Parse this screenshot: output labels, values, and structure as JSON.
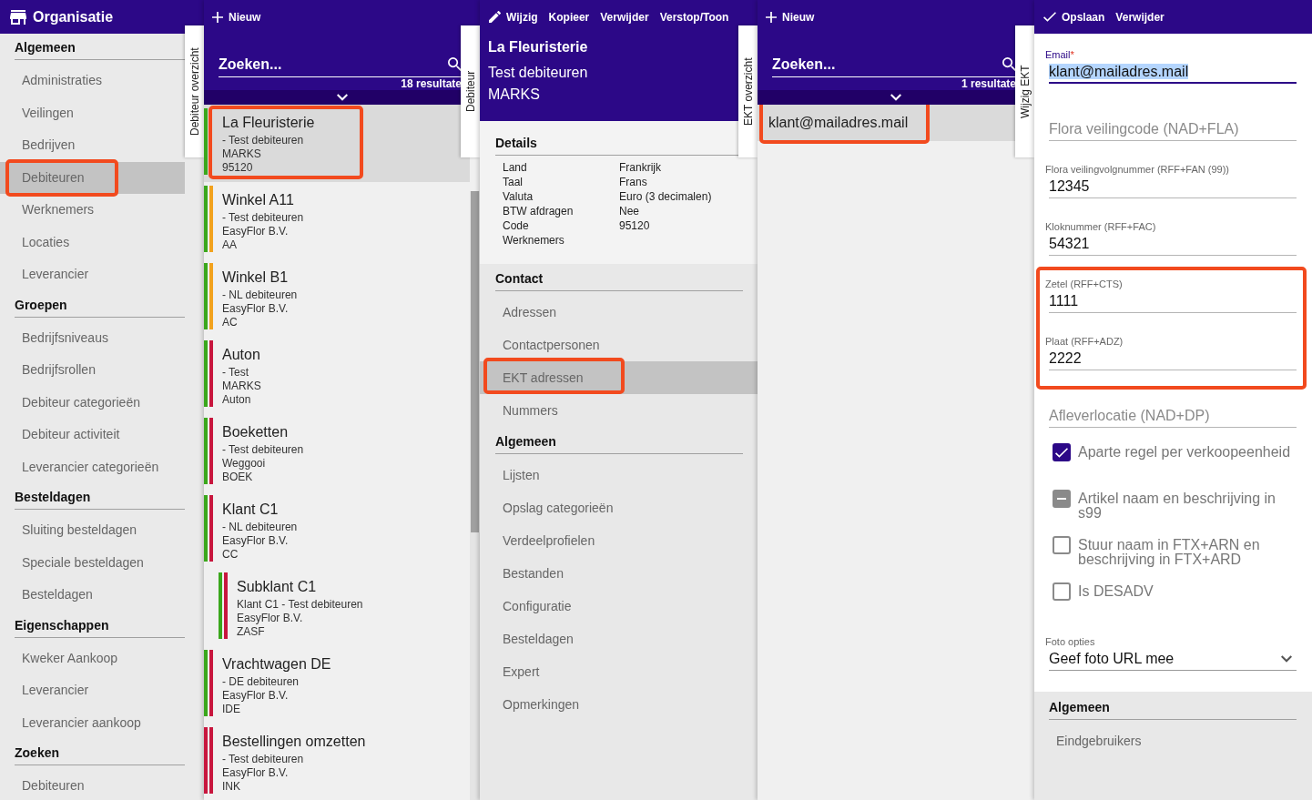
{
  "sidebar": {
    "title": "Organisatie",
    "side_tab": "Debiteur overzicht",
    "sections": [
      {
        "heading": "Algemeen",
        "items": [
          {
            "label": "Administraties",
            "selected": false,
            "highlighted": false
          },
          {
            "label": "Veilingen",
            "selected": false,
            "highlighted": false
          },
          {
            "label": "Bedrijven",
            "selected": false,
            "highlighted": false
          },
          {
            "label": "Debiteuren",
            "selected": true,
            "highlighted": true
          },
          {
            "label": "Werknemers",
            "selected": false,
            "highlighted": false
          },
          {
            "label": "Locaties",
            "selected": false,
            "highlighted": false
          },
          {
            "label": "Leverancier",
            "selected": false,
            "highlighted": false
          }
        ]
      },
      {
        "heading": "Groepen",
        "items": [
          {
            "label": "Bedrijfsniveaus",
            "selected": false,
            "highlighted": false
          },
          {
            "label": "Bedrijfsrollen",
            "selected": false,
            "highlighted": false
          },
          {
            "label": "Debiteur categorieën",
            "selected": false,
            "highlighted": false
          },
          {
            "label": "Debiteur activiteit",
            "selected": false,
            "highlighted": false
          },
          {
            "label": "Leverancier categorieën",
            "selected": false,
            "highlighted": false
          }
        ]
      },
      {
        "heading": "Besteldagen",
        "items": [
          {
            "label": "Sluiting besteldagen",
            "selected": false,
            "highlighted": false
          },
          {
            "label": "Speciale besteldagen",
            "selected": false,
            "highlighted": false
          },
          {
            "label": "Besteldagen",
            "selected": false,
            "highlighted": false
          }
        ]
      },
      {
        "heading": "Eigenschappen",
        "items": [
          {
            "label": "Kweker Aankoop",
            "selected": false,
            "highlighted": false
          },
          {
            "label": "Leverancier",
            "selected": false,
            "highlighted": false
          },
          {
            "label": "Leverancier aankoop",
            "selected": false,
            "highlighted": false
          }
        ]
      },
      {
        "heading": "Zoeken",
        "items": [
          {
            "label": "Debiteuren",
            "selected": false,
            "highlighted": false
          }
        ]
      }
    ]
  },
  "debtor_list": {
    "toolbar": [
      {
        "kind": "add",
        "label": "Nieuw"
      }
    ],
    "search": {
      "placeholder": "Zoeken..."
    },
    "result_count": "18 resultate",
    "side_tab": "Debiteur",
    "items": [
      {
        "title": "La Fleuristerie",
        "lines": [
          "- Test debiteuren",
          "MARKS",
          "95120"
        ],
        "bars": [
          {
            "color": "#3aa71c"
          }
        ],
        "selected": true,
        "highlighted": true
      },
      {
        "title": "Winkel A11",
        "lines": [
          "- Test debiteuren",
          "EasyFlor B.V.",
          "AA"
        ],
        "bars": [
          {
            "color": "#3aa71c"
          },
          {
            "color": "#f2a21e"
          }
        ],
        "selected": false,
        "highlighted": false
      },
      {
        "title": "Winkel B1",
        "lines": [
          "- NL debiteuren",
          "EasyFlor B.V.",
          "AC"
        ],
        "bars": [
          {
            "color": "#3aa71c"
          },
          {
            "color": "#f2a21e"
          }
        ],
        "selected": false,
        "highlighted": false
      },
      {
        "title": "Auton",
        "lines": [
          "- Test",
          "MARKS",
          "Auton"
        ],
        "bars": [
          {
            "color": "#3aa71c"
          },
          {
            "color": "#c8163e"
          }
        ],
        "selected": false,
        "highlighted": false
      },
      {
        "title": "Boeketten",
        "lines": [
          "- Test debiteuren",
          "Weggooi",
          "BOEK"
        ],
        "bars": [
          {
            "color": "#3aa71c"
          },
          {
            "color": "#c8163e"
          }
        ],
        "selected": false,
        "highlighted": false
      },
      {
        "title": "Klant C1",
        "lines": [
          "- NL debiteuren",
          "EasyFlor B.V.",
          "CC"
        ],
        "bars": [
          {
            "color": "#3aa71c"
          },
          {
            "color": "#c8163e"
          }
        ],
        "selected": false,
        "highlighted": false,
        "children": [
          {
            "title": "Subklant C1",
            "lines": [
              "Klant C1 - Test debiteuren",
              "EasyFlor B.V.",
              "ZASF"
            ],
            "bars": [
              {
                "color": "#3aa71c"
              },
              {
                "color": "#c8163e"
              }
            ],
            "selected": false,
            "highlighted": false
          }
        ]
      },
      {
        "title": "Vrachtwagen DE",
        "lines": [
          "- DE debiteuren",
          "EasyFlor B.V.",
          "IDE"
        ],
        "bars": [
          {
            "color": "#3aa71c"
          },
          {
            "color": "#c8163e"
          }
        ],
        "selected": false,
        "highlighted": false
      },
      {
        "title": "Bestellingen omzetten",
        "lines": [
          "- Test debiteuren",
          "EasyFlor B.V.",
          "INK"
        ],
        "bars": [
          {
            "color": "#c8163e"
          },
          {
            "color": "#c8163e"
          }
        ],
        "selected": false,
        "highlighted": false
      }
    ]
  },
  "debtor_detail": {
    "toolbar": [
      {
        "kind": "edit",
        "label": "Wijzig"
      },
      {
        "kind": "text",
        "label": "Kopieer"
      },
      {
        "kind": "text",
        "label": "Verwijder"
      },
      {
        "kind": "text",
        "label": "Verstop/Toon"
      }
    ],
    "title": "La Fleuristerie",
    "lines": [
      "Test debiteuren",
      "MARKS"
    ],
    "side_tab": "EKT overzicht",
    "details": {
      "heading": "Details",
      "rows": [
        {
          "label": "Land",
          "value": "Frankrijk"
        },
        {
          "label": "Taal",
          "value": "Frans"
        },
        {
          "label": "Valuta",
          "value": "Euro (3 decimalen)"
        },
        {
          "label": "BTW afdragen",
          "value": "Nee"
        },
        {
          "label": "Code",
          "value": "95120"
        },
        {
          "label": "Werknemers"
        }
      ]
    },
    "sections": [
      {
        "heading": "Contact",
        "items": [
          {
            "label": "Adressen",
            "selected": false,
            "highlighted": false
          },
          {
            "label": "Contactpersonen",
            "selected": false,
            "highlighted": false
          },
          {
            "label": "EKT adressen",
            "selected": true,
            "highlighted": true
          },
          {
            "label": "Nummers",
            "selected": false,
            "highlighted": false
          }
        ]
      },
      {
        "heading": "Algemeen",
        "items": [
          {
            "label": "Lijsten",
            "selected": false,
            "highlighted": false
          },
          {
            "label": "Opslag categorieën",
            "selected": false,
            "highlighted": false
          },
          {
            "label": "Verdeelprofielen",
            "selected": false,
            "highlighted": false
          },
          {
            "label": "Bestanden",
            "selected": false,
            "highlighted": false
          },
          {
            "label": "Configuratie",
            "selected": false,
            "highlighted": false
          },
          {
            "label": "Besteldagen",
            "selected": false,
            "highlighted": false
          },
          {
            "label": "Expert",
            "selected": false,
            "highlighted": false
          },
          {
            "label": "Opmerkingen",
            "selected": false,
            "highlighted": false
          }
        ]
      }
    ]
  },
  "ekt_list": {
    "toolbar": [
      {
        "kind": "add",
        "label": "Nieuw"
      }
    ],
    "search": {
      "placeholder": "Zoeken..."
    },
    "result_count": "1 resultate",
    "side_tab": "Wijzig EKT",
    "items": [
      {
        "label": "klant@mailadres.mail",
        "selected": true,
        "highlighted": true
      }
    ]
  },
  "ekt_form": {
    "toolbar": [
      {
        "kind": "save",
        "label": "Opslaan"
      },
      {
        "kind": "text",
        "label": "Verwijder"
      }
    ],
    "fields": [
      {
        "kind": "text",
        "label": "Email",
        "required_mark": "*",
        "value": "klant@mailadres.mail",
        "focused": true,
        "text_selected": true
      },
      {
        "kind": "text",
        "placeholder": "Flora veilingcode (NAD+FLA)",
        "focused": false
      },
      {
        "kind": "text",
        "label": "Flora veilingvolgnummer (RFF+FAN (99))",
        "value": "12345",
        "focused": false,
        "text_selected": false
      },
      {
        "kind": "text",
        "label": "Kloknummer (RFF+FAC)",
        "value": "54321",
        "focused": false,
        "text_selected": false
      },
      {
        "kind": "group",
        "highlighted": true,
        "fields": [
          {
            "kind": "text",
            "label": "Zetel (RFF+CTS)",
            "value": "1111",
            "focused": false,
            "text_selected": false
          },
          {
            "kind": "text",
            "label": "Plaat (RFF+ADZ)",
            "value": "2222",
            "focused": false,
            "text_selected": false
          }
        ]
      },
      {
        "kind": "text",
        "placeholder": "Afleverlocatie (NAD+DP)",
        "focused": false
      },
      {
        "kind": "checkbox",
        "label": "Aparte regel per verkoopeenheid",
        "checked": true,
        "indeterminate": false
      },
      {
        "kind": "checkbox",
        "label": "Artikel naam en beschrijving in s99",
        "checked": false,
        "indeterminate": true
      },
      {
        "kind": "checkbox",
        "label": "Stuur naam in FTX+ARN en beschrijving in FTX+ARD",
        "checked": false,
        "indeterminate": false
      },
      {
        "kind": "checkbox",
        "label": "Is DESADV",
        "checked": false,
        "indeterminate": false
      },
      {
        "kind": "select",
        "label": "Foto opties",
        "value": "Geef foto URL mee"
      }
    ],
    "sections": [
      {
        "heading": "Algemeen",
        "items": [
          {
            "label": "Eindgebruikers",
            "selected": false
          }
        ]
      }
    ]
  }
}
